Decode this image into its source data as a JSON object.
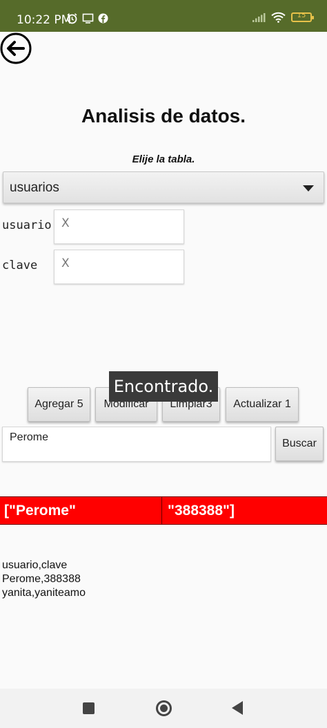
{
  "status_bar": {
    "time": "10:22 PM",
    "battery": "15",
    "icons_left": [
      "alarm-icon",
      "cast-icon",
      "facebook-icon"
    ],
    "icons_right": [
      "signal-icon",
      "wifi-icon",
      "battery-icon"
    ]
  },
  "header": {
    "title": "Analisis de datos.",
    "subtitle": "Elije la tabla."
  },
  "table_selector": {
    "selected": "usuarios"
  },
  "fields": [
    {
      "label": "usuario",
      "placeholder": "X"
    },
    {
      "label": "clave",
      "placeholder": "X"
    }
  ],
  "toast": "Encontrado.",
  "buttons": {
    "add": "Agregar 5",
    "modify": "Modificar",
    "clear": "Limpiar3",
    "update": "Actualizar 1"
  },
  "search": {
    "value": "Perome",
    "button": "Buscar"
  },
  "result": {
    "cells": [
      "[\"Perome\"",
      "\"388388\"]"
    ]
  },
  "csv_lines": [
    "usuario,clave",
    "Perome,388388",
    "yanita,yaniteamo"
  ],
  "colors": {
    "status_bar": "#566b2a",
    "result_row": "#ff0000",
    "toast": "#3a3a3a"
  }
}
